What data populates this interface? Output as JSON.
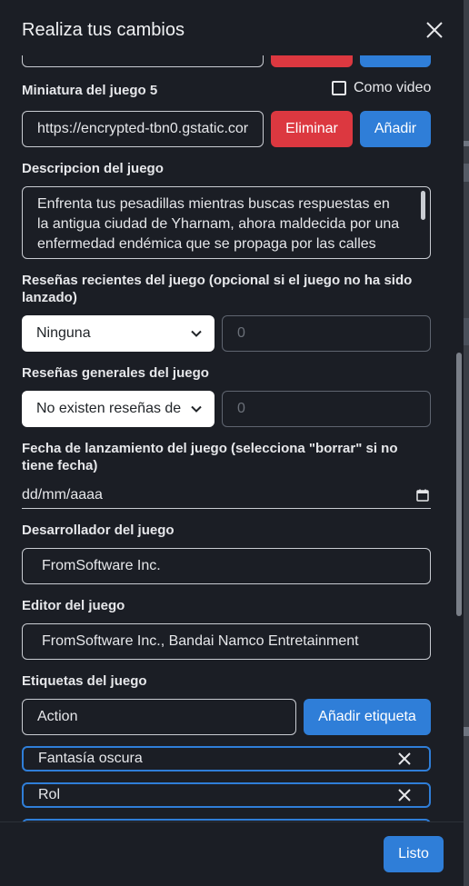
{
  "modal": {
    "title": "Realiza tus cambios"
  },
  "thumbnail": {
    "label": "Miniatura del juego 5",
    "as_video_label": "Como video",
    "url_value": "https://encrypted-tbn0.gstatic.cor",
    "remove_label": "Eliminar",
    "add_label": "Añadir"
  },
  "description": {
    "label": "Descripcion del juego",
    "lines": [
      "Enfrenta tus pesadillas mientras buscas respuestas en",
      "la antigua ciudad de Yharnam, ahora maldecida por una",
      "enfermedad endémica que se propaga por las calles"
    ]
  },
  "recent_reviews": {
    "label_line1": "Reseñas recientes del juego (opcional si el juego no ha sido",
    "label_line2": "lanzado)",
    "selected": "Ninguna",
    "count_placeholder": "0"
  },
  "general_reviews": {
    "label": "Reseñas generales del juego",
    "selected": "No existen reseñas de",
    "count_placeholder": "0"
  },
  "release_date": {
    "label_line1": "Fecha de lanzamiento del juego (selecciona \"borrar\" si no",
    "label_line2": "tiene fecha)",
    "placeholder": "dd/mm/aaaa"
  },
  "developer": {
    "label": "Desarrollador del juego",
    "value": "FromSoftware Inc."
  },
  "publisher": {
    "label": "Editor del juego",
    "value": "FromSoftware Inc., Bandai Namco Entretainment"
  },
  "tags": {
    "label": "Etiquetas del juego",
    "input_value": "Action",
    "add_label": "Añadir etiqueta",
    "items": [
      "Fantasía oscura",
      "Rol"
    ]
  },
  "footer": {
    "done_label": "Listo"
  },
  "colors": {
    "background": "#1b1e25",
    "primary": "#2f7ed8",
    "danger": "#dc3840"
  }
}
